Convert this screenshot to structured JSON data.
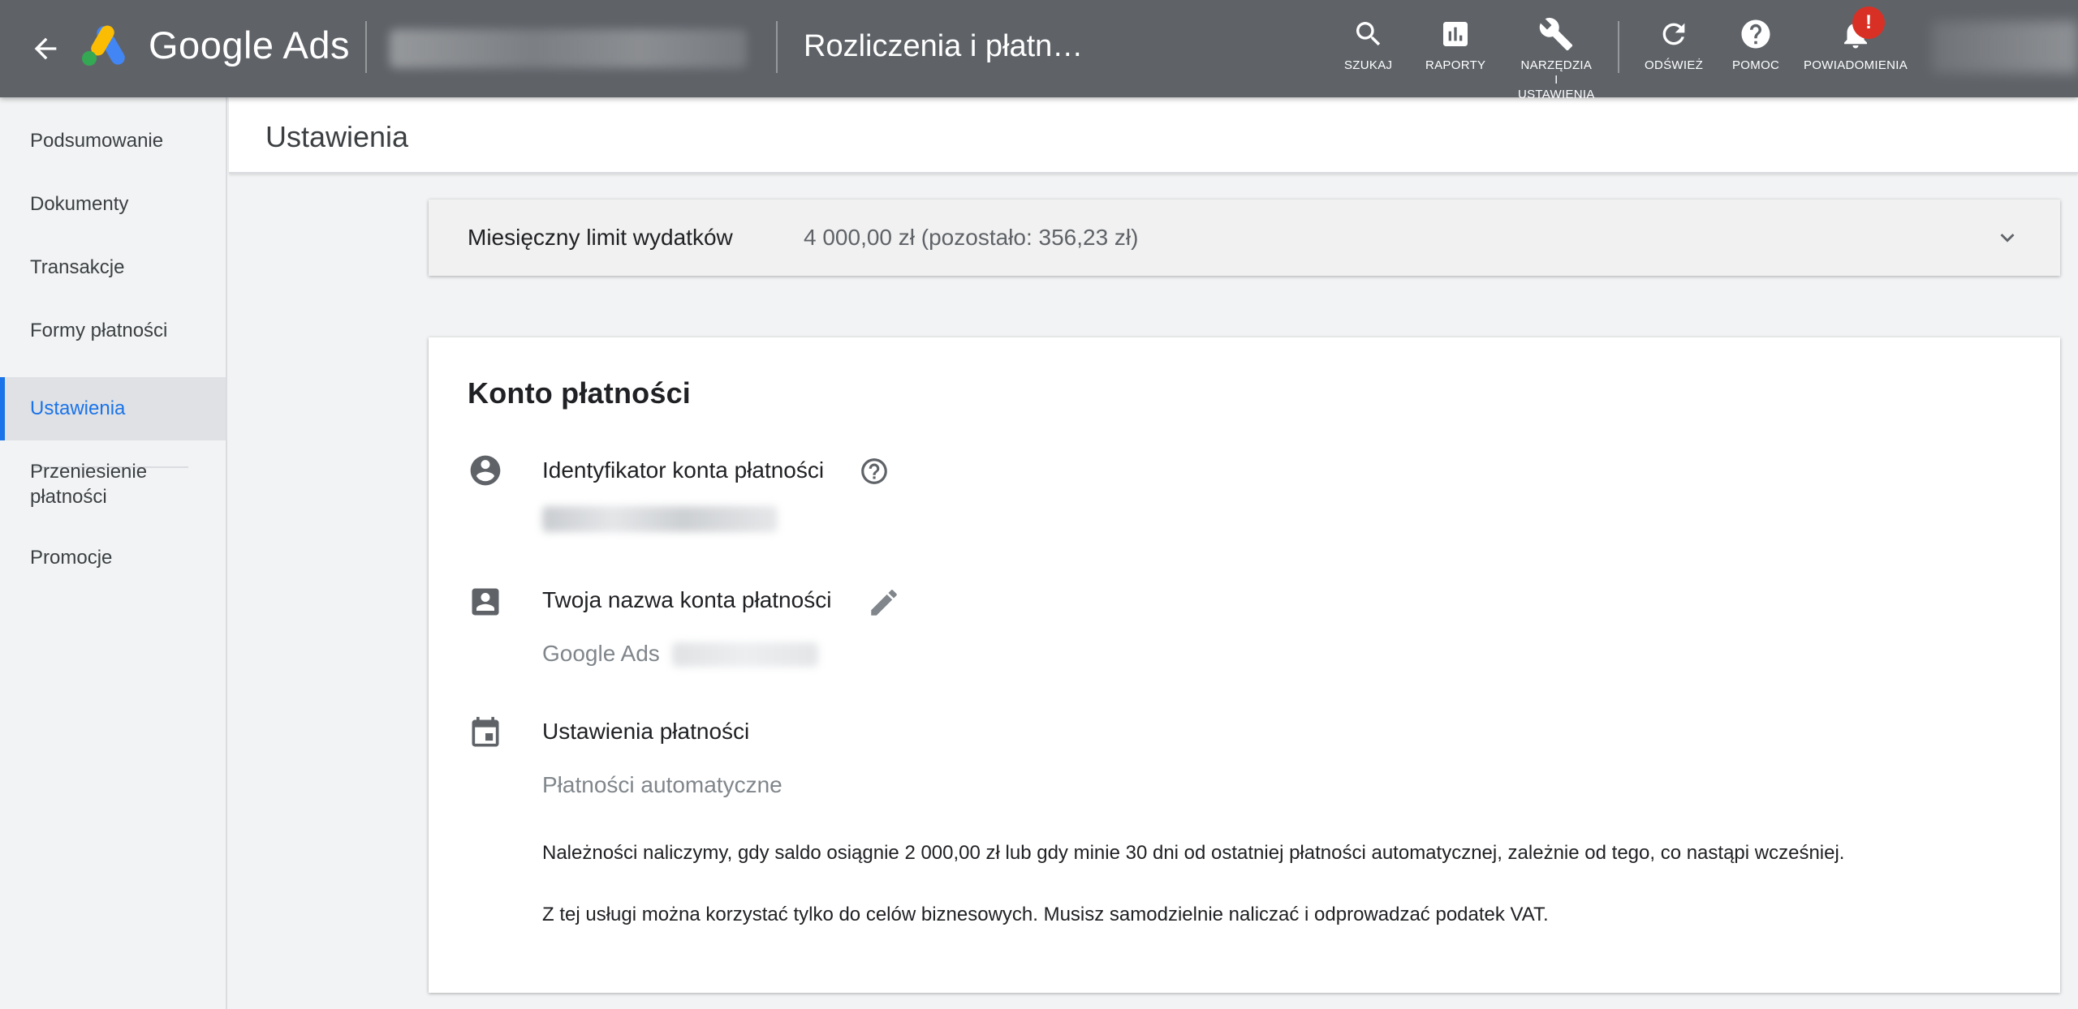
{
  "topbar": {
    "brand": "Google Ads",
    "page_title": "Rozliczenia i płatn…",
    "tools": {
      "search": "SZUKAJ",
      "reports": "RAPORTY",
      "tools_line1": "NARZĘDZIA",
      "tools_line2": "I",
      "tools_line3": "USTAWIENIA",
      "refresh": "ODŚWIEŻ",
      "help": "POMOC",
      "notifications": "POWIADOMIENIA"
    },
    "notification_badge": "!"
  },
  "sidenav": {
    "items": [
      {
        "label": "Podsumowanie"
      },
      {
        "label": "Dokumenty"
      },
      {
        "label": "Transakcje"
      },
      {
        "label": "Formy płatności"
      },
      {
        "label": "Ustawienia"
      },
      {
        "label_line1": "Przeniesienie",
        "label_line2": "płatności"
      },
      {
        "label": "Promocje"
      }
    ]
  },
  "subheader": {
    "title": "Ustawienia"
  },
  "limit": {
    "label": "Miesięczny limit wydatków",
    "value": "4 000,00 zł (pozostało: 356,23 zł)"
  },
  "card": {
    "title": "Konto płatności",
    "account_id_label": "Identyfikator konta płatności",
    "account_name_label": "Twoja nazwa konta płatności",
    "account_name_value": "Google Ads",
    "payment_settings_label": "Ustawienia płatności",
    "payment_settings_value": "Płatności automatyczne",
    "note1": "Należności naliczymy, gdy saldo osiągnie 2 000,00 zł lub gdy minie 30 dni od ostatniej płatności automatycznej, zależnie od tego, co nastąpi wcześniej.",
    "note2": "Z tej usługi można korzystać tylko do celów biznesowych. Musisz samodzielnie naliczać i odprowadzać podatek VAT."
  },
  "colors": {
    "topbar": "#5f6368",
    "accent": "#1a73e8",
    "badge": "#d93025"
  }
}
